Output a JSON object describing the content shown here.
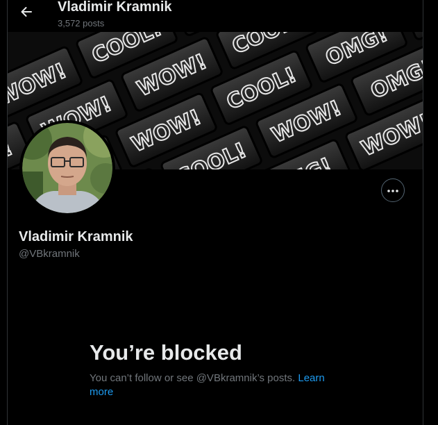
{
  "header": {
    "back_icon": "arrow-left-icon",
    "name": "Vladimir Kramnik",
    "posts": "3,572 posts"
  },
  "banner": {
    "words": [
      "OMG!",
      "WOW!",
      "COOL!",
      "WOW!",
      "COOL!",
      "WOW!",
      "OMG!",
      "WOW!",
      "WOW!",
      "COOL!",
      "WOW!",
      "OMG!",
      "WOW!",
      "COOL!",
      "WOW!",
      "COOL!"
    ]
  },
  "profile": {
    "name": "Vladimir Kramnik",
    "handle": "@VBkramnik",
    "more_icon": "more-horizontal-icon"
  },
  "blocked": {
    "title": "You’re blocked",
    "message": "You can’t follow or see @VBkramnik’s posts.",
    "link": "Learn more"
  },
  "colors": {
    "background": "#000000",
    "text": "#e7e9ea",
    "muted": "#71767b",
    "link": "#1d9bf0",
    "border": "#2f3336"
  }
}
